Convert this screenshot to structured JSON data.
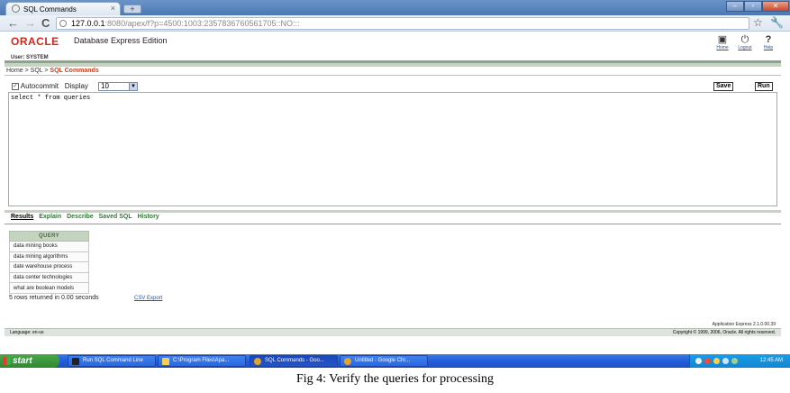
{
  "browser": {
    "tab_title": "SQL Commands",
    "tab_close": "×",
    "new_tab": "+",
    "window_controls": [
      "–",
      "▫",
      "✕"
    ],
    "url_host": "127.0.0.1",
    "url_rest": ":8080/apex/f?p=4500:1003:2357836760561705::NO:::",
    "back_icon": "arrow-left",
    "forward_icon": "arrow-right",
    "reload_icon": "reload",
    "star_icon": "star",
    "wrench_icon": "wrench"
  },
  "header": {
    "logo": "ORACLE",
    "product": "Database Express Edition",
    "user_label": "User: SYSTEM",
    "nav": [
      {
        "label": "Home",
        "icon": "home-icon"
      },
      {
        "label": "Logout",
        "icon": "logout-icon"
      },
      {
        "label": "Help",
        "icon": "help-icon"
      }
    ]
  },
  "breadcrumb": {
    "items": [
      "Home",
      "SQL"
    ],
    "separator": " > ",
    "current": "SQL Commands"
  },
  "options": {
    "autocommit_label": "Autocommit",
    "autocommit_checked": true,
    "display_label": "Display",
    "display_value": "10",
    "save_label": "Save",
    "run_label": "Run"
  },
  "editor": {
    "sql": "select * from queries"
  },
  "results": {
    "tabs": [
      "Results",
      "Explain",
      "Describe",
      "Saved SQL",
      "History"
    ],
    "active_tab": "Results",
    "column_header": "QUERY",
    "rows": [
      "data mining books",
      "data mining algorithms",
      "date warehouse process",
      "data center technologies",
      "what are boolean models"
    ],
    "summary": "5 rows returned in 0.00 seconds",
    "csv_export": "CSV Export"
  },
  "footer": {
    "version": "Application Express 2.1.0.00.39",
    "language": "Language: en-us",
    "copyright": "Copyright © 1999, 2006, Oracle. All rights reserved."
  },
  "taskbar": {
    "start_label": "start",
    "tasks": [
      "Run SQL Command Line",
      "C:\\Program Files\\Apa...",
      "SQL Commands - Goo...",
      "Untitled - Google Chr..."
    ],
    "active_task_index": 2,
    "clock": "12:45 AM"
  },
  "caption": "Fig 4: Verify the queries for processing",
  "colors": {
    "oracle_red": "#d3281b",
    "breadcrumb_current": "#c6441d",
    "results_tab_green": "#2e7d32",
    "table_header_bg": "#c4d4bf",
    "taskbar_blue": "#245edb",
    "start_green": "#3a9a3a"
  }
}
